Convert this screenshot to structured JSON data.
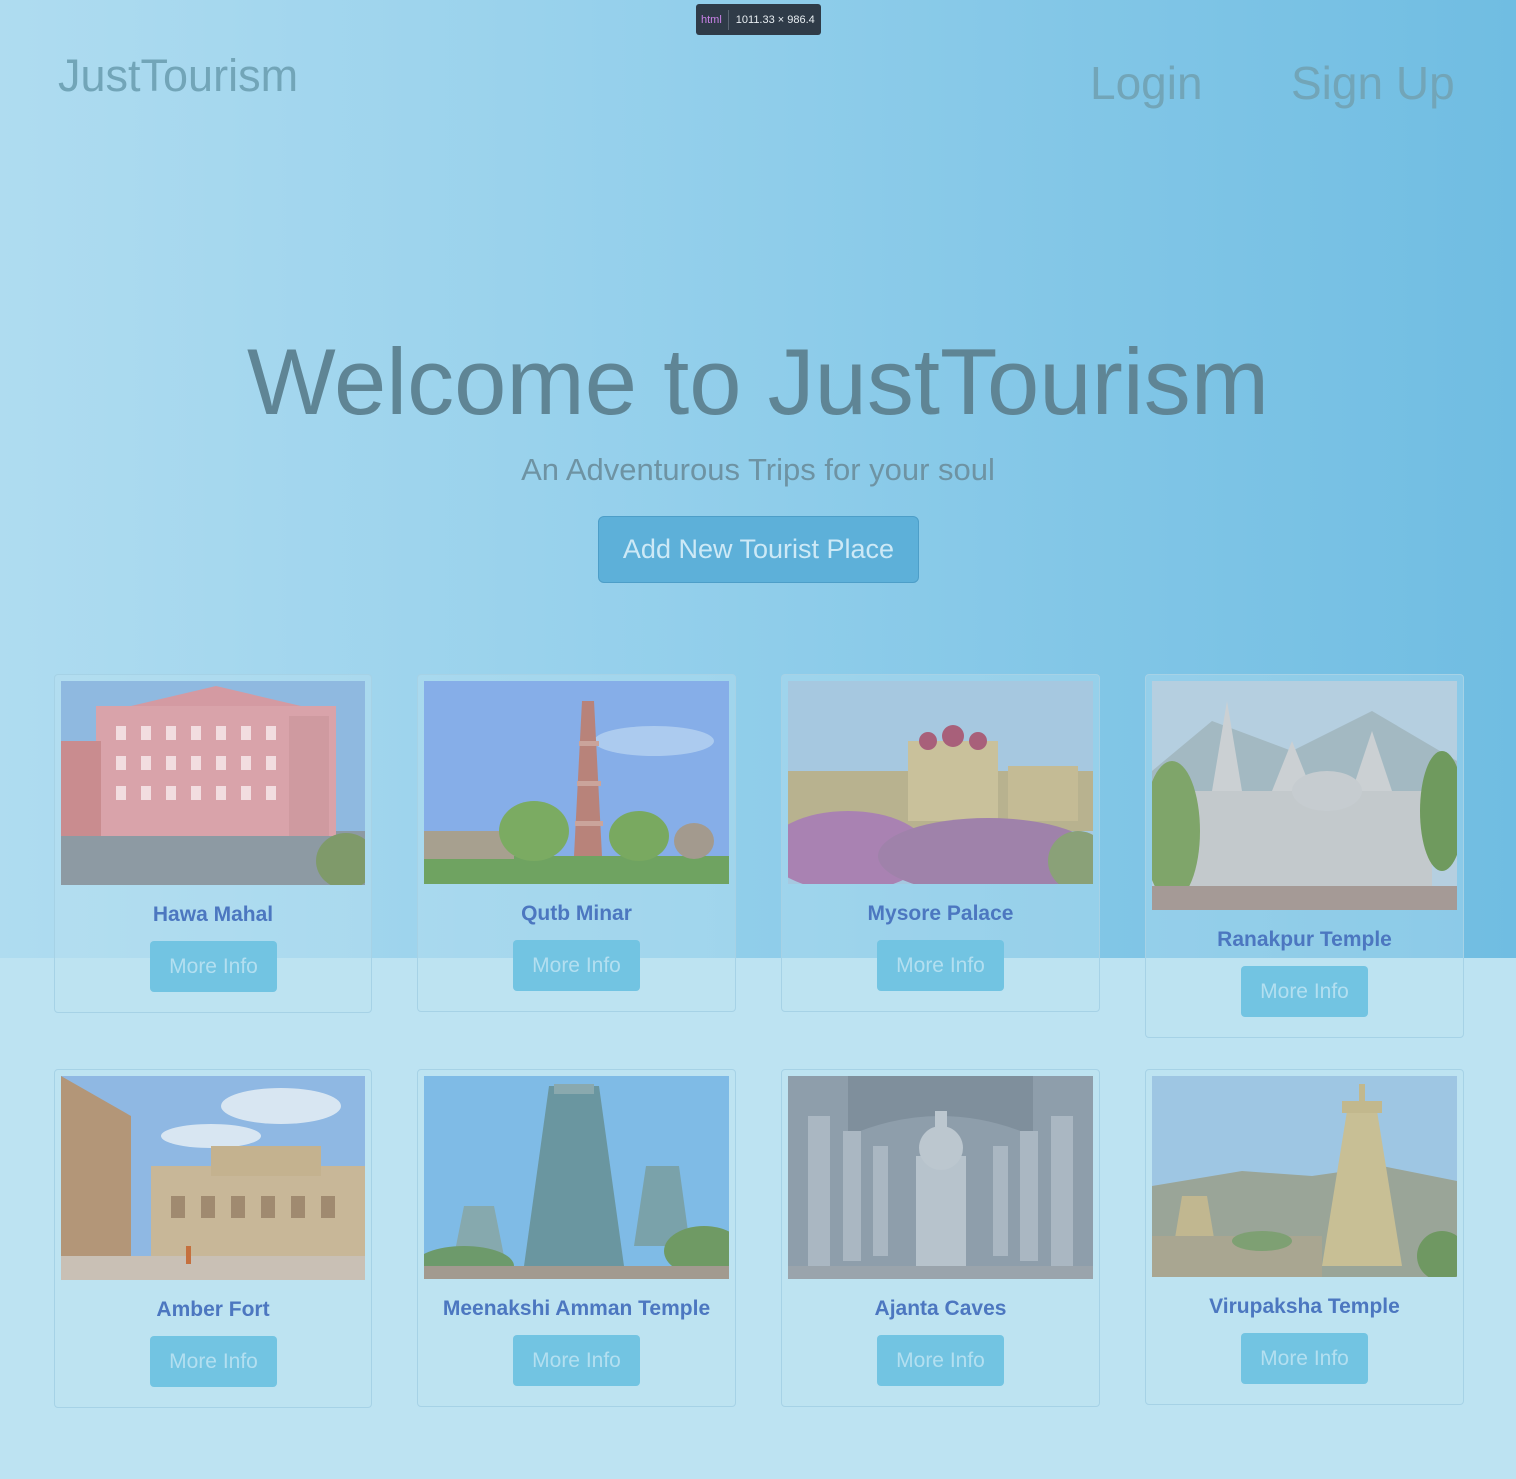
{
  "devtools": {
    "tag": "html",
    "dims": "1011.33 × 986.4"
  },
  "header": {
    "logo": "JustTourism",
    "login": "Login",
    "signup": "Sign Up"
  },
  "hero": {
    "title": "Welcome to JustTourism",
    "subtitle": "An Adventurous Trips for your soul",
    "add_button": "Add New Tourist Place"
  },
  "cards": [
    {
      "name": "Hawa Mahal",
      "button": "More Info"
    },
    {
      "name": "Qutb Minar",
      "button": "More Info"
    },
    {
      "name": "Mysore Palace",
      "button": "More Info"
    },
    {
      "name": "Ranakpur Temple",
      "button": "More Info"
    },
    {
      "name": "Amber Fort",
      "button": "More Info"
    },
    {
      "name": "Meenakshi Amman Temple",
      "button": "More Info"
    },
    {
      "name": "Ajanta Caves",
      "button": "More Info"
    },
    {
      "name": "Virupaksha Temple",
      "button": "More Info"
    }
  ]
}
